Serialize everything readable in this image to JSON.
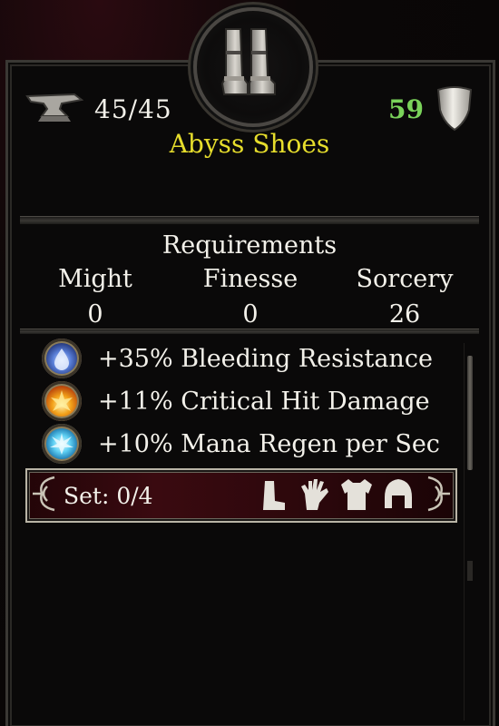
{
  "item": {
    "name": "Abyss Shoes",
    "durability": "45/45",
    "armor": "59",
    "icon": "boots-icon"
  },
  "requirements": {
    "title": "Requirements",
    "might_label": "Might",
    "might_value": "0",
    "finesse_label": "Finesse",
    "finesse_value": "0",
    "sorcery_label": "Sorcery",
    "sorcery_value": "26"
  },
  "stats": [
    {
      "text": "+35% Bleeding Resistance",
      "icon": "blood-drop-orb-icon",
      "color": "#5a7fd8"
    },
    {
      "text": "+11% Critical Hit Damage",
      "icon": "fire-burst-orb-icon",
      "color": "#f3a21a"
    },
    {
      "text": "+10% Mana Regen per Sec",
      "icon": "ice-burst-orb-icon",
      "color": "#5fd0f3"
    }
  ],
  "set": {
    "label": "Set: 0/4",
    "pieces": [
      "boots-icon",
      "gloves-icon",
      "chest-armor-icon",
      "helmet-icon"
    ]
  },
  "colors": {
    "name": "#e6dd2c",
    "armor": "#7ad35a",
    "text": "#f3f1ea"
  }
}
